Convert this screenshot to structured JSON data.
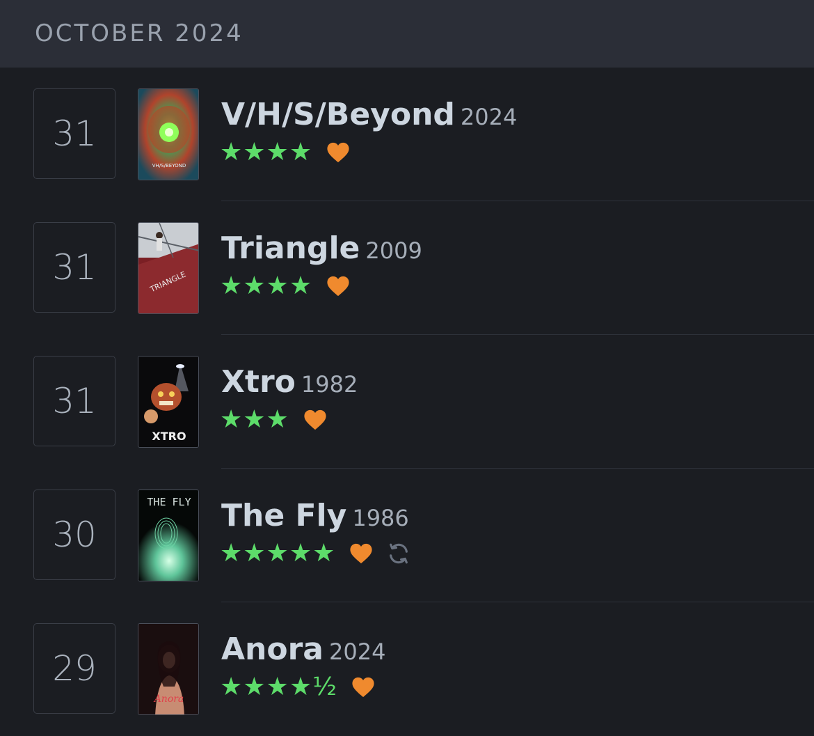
{
  "header": {
    "title": "OCTOBER 2024"
  },
  "colors": {
    "stars": "#5ddc6a",
    "heart": "#f08a2e",
    "rewatch": "#6a7280"
  },
  "entries": [
    {
      "day": "31",
      "title": "V/H/S/Beyond",
      "year": "2024",
      "stars": "★★★★",
      "rating": 4,
      "liked": true,
      "rewatch": false,
      "poster_text": "VH/S/BEYOND",
      "poster_icon": "vhs-beyond-poster"
    },
    {
      "day": "31",
      "title": "Triangle",
      "year": "2009",
      "stars": "★★★★",
      "rating": 4,
      "liked": true,
      "rewatch": false,
      "poster_text": "TRIANGLE",
      "poster_icon": "triangle-poster"
    },
    {
      "day": "31",
      "title": "Xtro",
      "year": "1982",
      "stars": "★★★",
      "rating": 3,
      "liked": true,
      "rewatch": false,
      "poster_text": "XTRO",
      "poster_icon": "xtro-poster"
    },
    {
      "day": "30",
      "title": "The Fly",
      "year": "1986",
      "stars": "★★★★★",
      "rating": 5,
      "liked": true,
      "rewatch": true,
      "poster_text": "THE FLY",
      "poster_icon": "the-fly-poster"
    },
    {
      "day": "29",
      "title": "Anora",
      "year": "2024",
      "stars": "★★★★½",
      "rating": 4.5,
      "liked": true,
      "rewatch": false,
      "poster_text": "Anora",
      "poster_icon": "anora-poster"
    }
  ]
}
